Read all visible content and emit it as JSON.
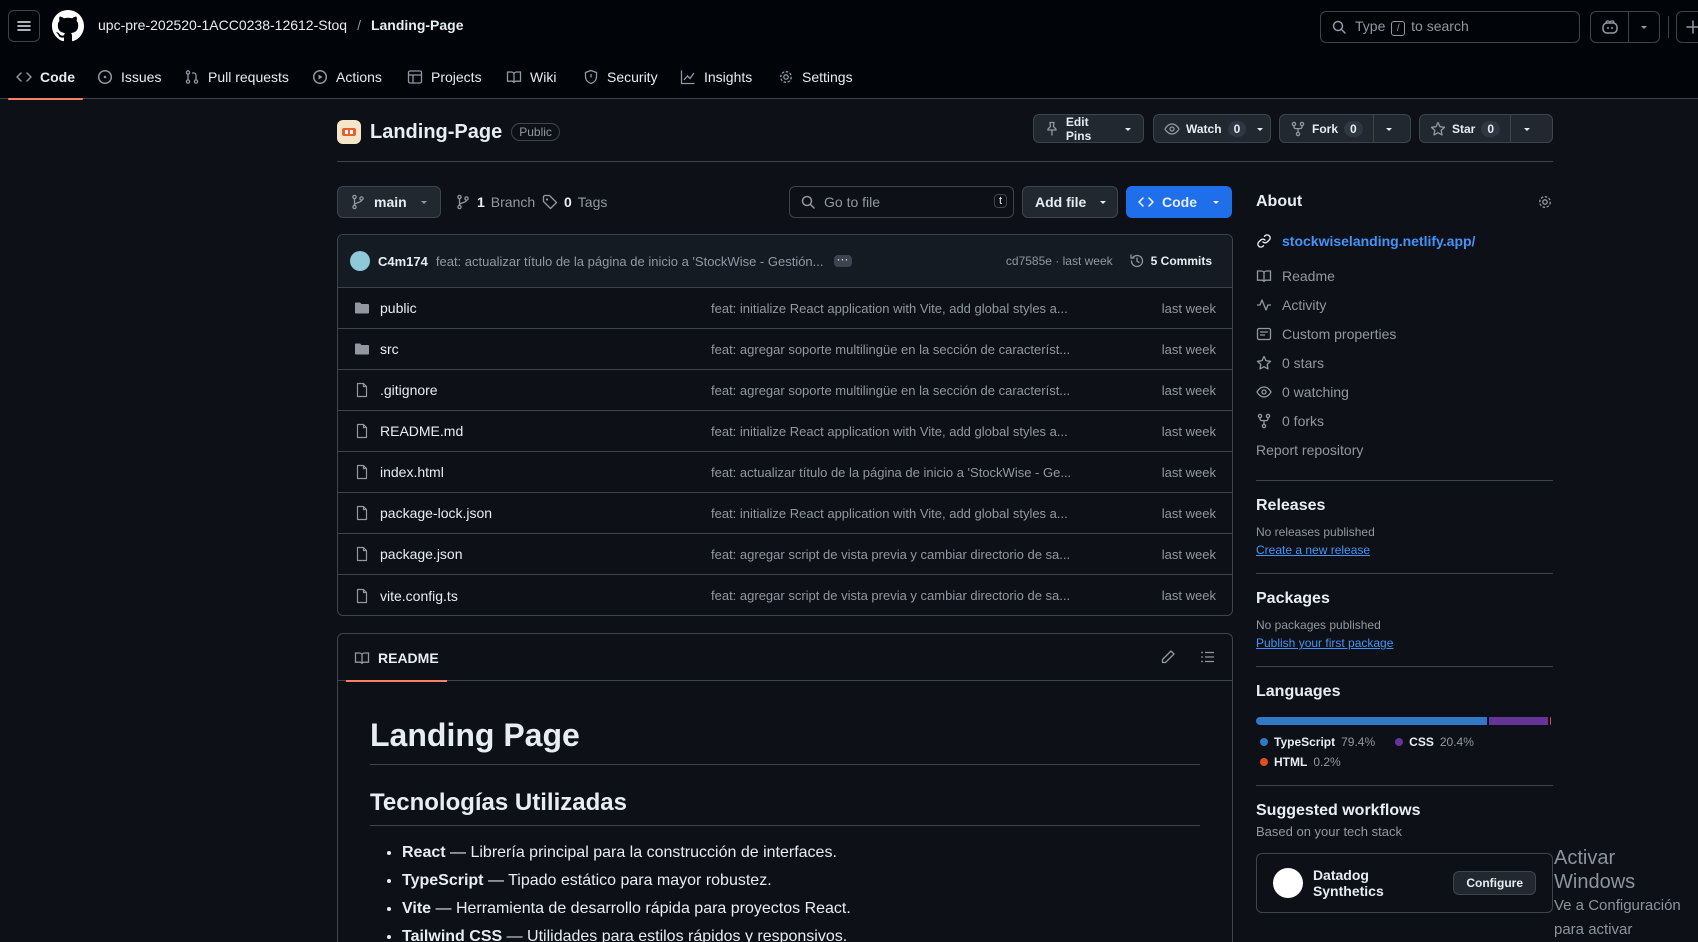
{
  "header": {
    "owner": "upc-pre-202520-1ACC0238-12612-Stoq",
    "separator": "/",
    "repo": "Landing-Page",
    "search_prefix": "Type",
    "search_key": "/",
    "search_suffix": "to search"
  },
  "tabs": [
    {
      "label": "Code"
    },
    {
      "label": "Issues"
    },
    {
      "label": "Pull requests"
    },
    {
      "label": "Actions"
    },
    {
      "label": "Projects"
    },
    {
      "label": "Wiki"
    },
    {
      "label": "Security"
    },
    {
      "label": "Insights"
    },
    {
      "label": "Settings"
    }
  ],
  "repo": {
    "name": "Landing-Page",
    "visibility": "Public",
    "edit_pins": "Edit Pins",
    "watch_label": "Watch",
    "watch_count": "0",
    "fork_label": "Fork",
    "fork_count": "0",
    "star_label": "Star",
    "star_count": "0"
  },
  "toolbar": {
    "branch": "main",
    "branch_count": "1",
    "branch_label": "Branch",
    "tag_count": "0",
    "tag_label": "Tags",
    "go_to_file": "Go to file",
    "go_to_file_key": "t",
    "add_file": "Add file",
    "code": "Code"
  },
  "commit": {
    "author": "C4m174",
    "message": "feat: actualizar título de la página de inicio a 'StockWise - Gestión...",
    "hash": "cd7585e",
    "time": "· last week",
    "commits": "5 Commits"
  },
  "files": [
    {
      "name": "public",
      "type": "dir",
      "message": "feat: initialize React application with Vite, add global styles a...",
      "time": "last week"
    },
    {
      "name": "src",
      "type": "dir",
      "message": "feat: agregar soporte multilingüe en la sección de característ...",
      "time": "last week"
    },
    {
      "name": ".gitignore",
      "type": "file",
      "message": "feat: agregar soporte multilingüe en la sección de característ...",
      "time": "last week"
    },
    {
      "name": "README.md",
      "type": "file",
      "message": "feat: initialize React application with Vite, add global styles a...",
      "time": "last week"
    },
    {
      "name": "index.html",
      "type": "file",
      "message": "feat: actualizar título de la página de inicio a 'StockWise - Ge...",
      "time": "last week"
    },
    {
      "name": "package-lock.json",
      "type": "file",
      "message": "feat: initialize React application with Vite, add global styles a...",
      "time": "last week"
    },
    {
      "name": "package.json",
      "type": "file",
      "message": "feat: agregar script de vista previa y cambiar directorio de sa...",
      "time": "last week"
    },
    {
      "name": "vite.config.ts",
      "type": "file",
      "message": "feat: agregar script de vista previa y cambiar directorio de sa...",
      "time": "last week"
    }
  ],
  "readme": {
    "tab": "README",
    "h1": "Landing Page",
    "h2": "Tecnologías Utilizadas",
    "items": [
      {
        "bold": "React",
        "text": " — Librería principal para la construcción de interfaces."
      },
      {
        "bold": "TypeScript",
        "text": " — Tipado estático para mayor robustez."
      },
      {
        "bold": "Vite",
        "text": " — Herramienta de desarrollo rápida para proyectos React."
      },
      {
        "bold": "Tailwind CSS",
        "text": " — Utilidades para estilos rápidos y responsivos."
      }
    ]
  },
  "about": {
    "title": "About",
    "url": "stockwiselanding.netlify.app/",
    "readme": "Readme",
    "activity": "Activity",
    "custom_properties": "Custom properties",
    "stars": "0 stars",
    "watching": "0 watching",
    "forks": "0 forks",
    "report": "Report repository"
  },
  "releases": {
    "title": "Releases",
    "none": "No releases published",
    "create": "Create a new release"
  },
  "packages": {
    "title": "Packages",
    "none": "No packages published",
    "publish": "Publish your first package"
  },
  "languages": {
    "title": "Languages",
    "items": [
      {
        "name": "TypeScript",
        "percent": "79.4%",
        "value": 79.4,
        "color": "#3178c6"
      },
      {
        "name": "CSS",
        "percent": "20.4%",
        "value": 20.4,
        "color": "#663399"
      },
      {
        "name": "HTML",
        "percent": "0.2%",
        "value": 0.2,
        "color": "#e34c26"
      }
    ]
  },
  "workflows": {
    "title": "Suggested workflows",
    "subtitle": "Based on your tech stack",
    "card_name": "Datadog Synthetics",
    "configure": "Configure"
  },
  "watermark": {
    "line1": "Activar Windows",
    "line2": "Ve a Configuración para activar Windows."
  }
}
